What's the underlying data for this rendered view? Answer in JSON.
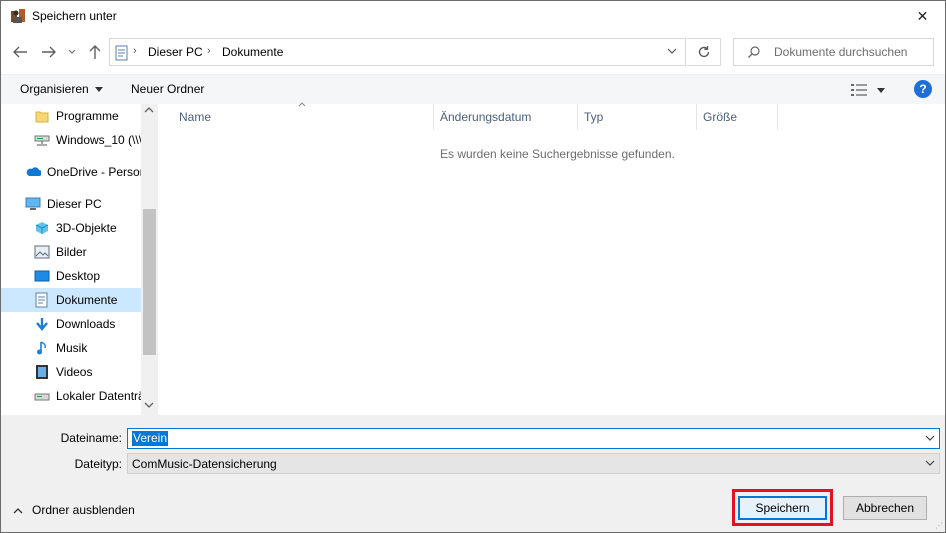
{
  "window": {
    "title": "Speichern unter",
    "close_glyph": "✕"
  },
  "address": {
    "crumbs": [
      "Dieser PC",
      "Dokumente"
    ],
    "search_placeholder": "Dokumente durchsuchen"
  },
  "toolbar": {
    "organize_label": "Organisieren",
    "new_folder_label": "Neuer Ordner",
    "help_glyph": "?"
  },
  "navpane": {
    "items": [
      {
        "label": "Programme",
        "icon": "folder-icon"
      },
      {
        "label": "Windows_10 (\\\\\\",
        "icon": "network-drive-icon"
      },
      {
        "label": "OneDrive - Persor",
        "icon": "onedrive-icon"
      },
      {
        "label": "Dieser PC",
        "icon": "computer-icon"
      },
      {
        "label": "3D-Objekte",
        "icon": "3d-objects-icon"
      },
      {
        "label": "Bilder",
        "icon": "pictures-icon"
      },
      {
        "label": "Desktop",
        "icon": "desktop-icon"
      },
      {
        "label": "Dokumente",
        "icon": "documents-icon",
        "selected": true
      },
      {
        "label": "Downloads",
        "icon": "downloads-icon"
      },
      {
        "label": "Musik",
        "icon": "music-icon"
      },
      {
        "label": "Videos",
        "icon": "videos-icon"
      },
      {
        "label": "Lokaler Datenträ",
        "icon": "local-disk-icon"
      }
    ]
  },
  "filelist": {
    "columns": [
      "Name",
      "Änderungsdatum",
      "Typ",
      "Größe"
    ],
    "empty_message": "Es wurden keine Suchergebnisse gefunden."
  },
  "form": {
    "filename_label": "Dateiname:",
    "filename_value": "Verein",
    "filetype_label": "Dateityp:",
    "filetype_value": "ComMusic-Datensicherung",
    "hide_folders_label": "Ordner ausblenden",
    "save_label": "Speichern",
    "cancel_label": "Abbrechen"
  },
  "colors": {
    "accent": "#0078d7",
    "highlight_box": "#e0151c",
    "selection_bg": "#cce8ff"
  }
}
